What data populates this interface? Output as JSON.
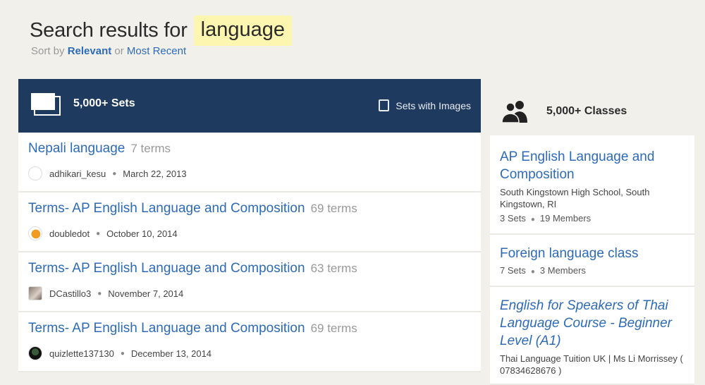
{
  "header": {
    "title_prefix": "Search results for",
    "query": "language",
    "sort_label": "Sort by",
    "sort_relevant": "Relevant",
    "sort_or": "or",
    "sort_recent": "Most Recent"
  },
  "sets": {
    "count_label": "5,000+ Sets",
    "filter_label": "Sets with Images",
    "items": [
      {
        "title": "Nepali language",
        "terms": "7 terms",
        "user": "adhikari_kesu",
        "date": "March 22, 2013",
        "avatar": "blank"
      },
      {
        "title": "Terms- AP English Language and Composition",
        "terms": "69 terms",
        "user": "doubledot",
        "date": "October 10, 2014",
        "avatar": "fish"
      },
      {
        "title": "Terms- AP English Language and Composition",
        "terms": "63 terms",
        "user": "DCastillo3",
        "date": "November 7, 2014",
        "avatar": "photo"
      },
      {
        "title": "Terms- AP English Language and Composition",
        "terms": "69 terms",
        "user": "quizlette137130",
        "date": "December 13, 2014",
        "avatar": "dark"
      }
    ]
  },
  "classes": {
    "count_label": "5,000+ Classes",
    "items": [
      {
        "title": "AP English Language and Composition",
        "school": "South Kingstown High School, South Kingstown, RI",
        "sets": "3 Sets",
        "members": "19 Members"
      },
      {
        "title": "Foreign language class",
        "school": "",
        "sets": "7 Sets",
        "members": "3 Members"
      },
      {
        "title": "English for Speakers of Thai Language Course - Beginner Level (A1)",
        "school": "Thai Language Tuition UK | Ms Li Morrissey ( 07834628676 )",
        "sets": "",
        "members": ""
      }
    ]
  },
  "colors": {
    "accent_link": "#2d6ab8",
    "sets_header_bg": "#1f3a5f",
    "query_highlight": "#fdf6b0"
  }
}
